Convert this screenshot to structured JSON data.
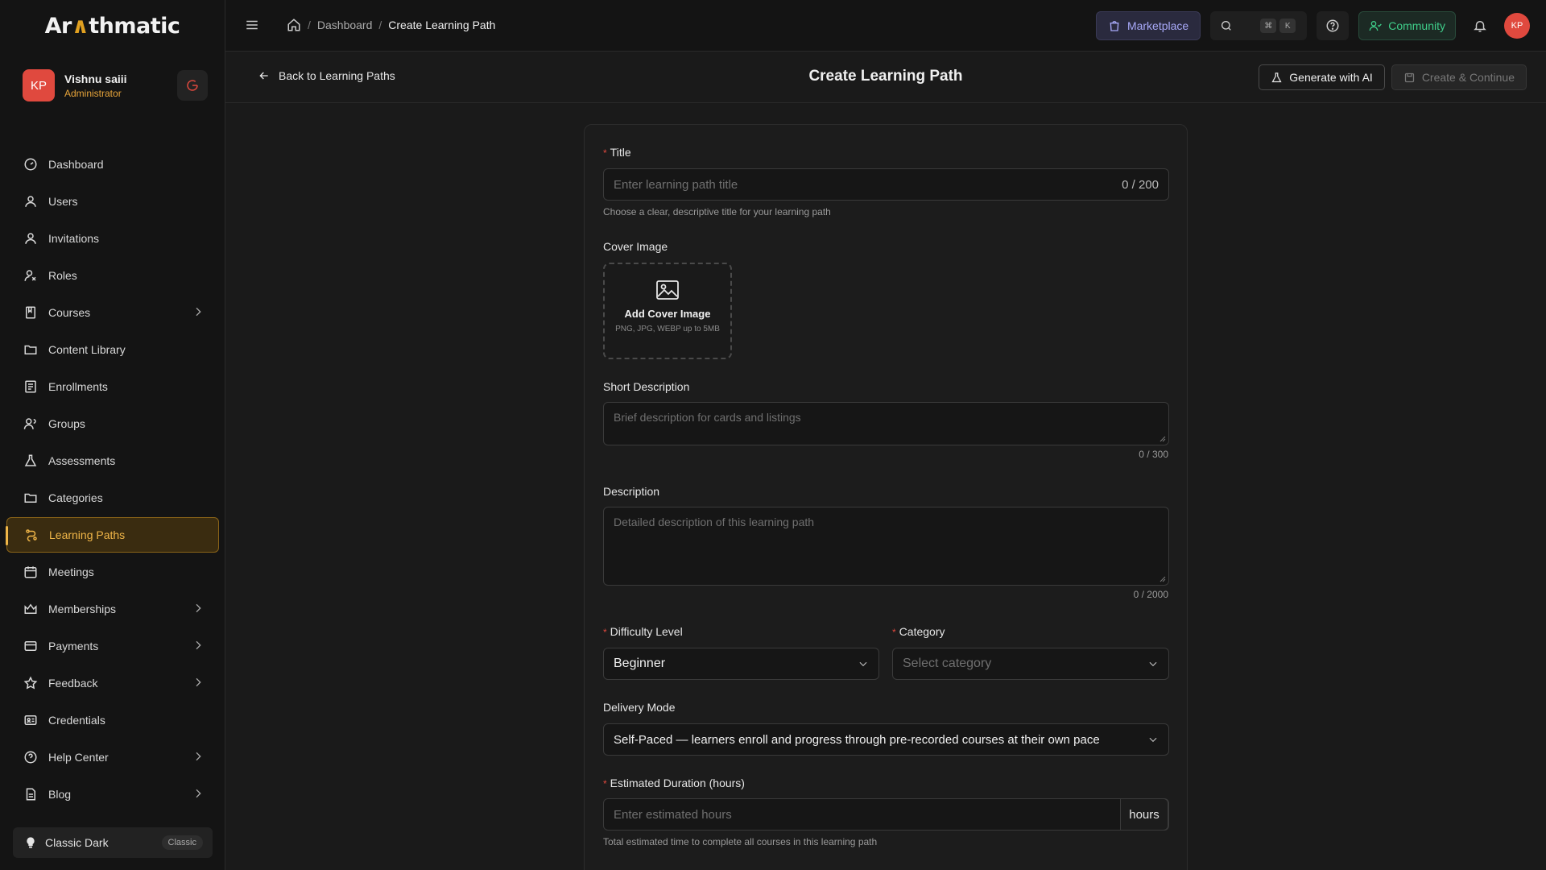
{
  "app": {
    "logo_prefix": "Ar",
    "logo_accent": "∧",
    "logo_suffix": "thmatic"
  },
  "user": {
    "initials": "KP",
    "name": "Vishnu saiii",
    "role": "Administrator"
  },
  "sidebar": {
    "items": [
      {
        "label": "Dashboard",
        "icon": "dashboard-icon"
      },
      {
        "label": "Users",
        "icon": "user-icon"
      },
      {
        "label": "Invitations",
        "icon": "user-icon"
      },
      {
        "label": "Roles",
        "icon": "roles-icon"
      },
      {
        "label": "Courses",
        "icon": "book-icon"
      },
      {
        "label": "Content Library",
        "icon": "folder-icon"
      },
      {
        "label": "Enrollments",
        "icon": "list-icon"
      },
      {
        "label": "Groups",
        "icon": "group-icon"
      },
      {
        "label": "Assessments",
        "icon": "flask-icon"
      },
      {
        "label": "Categories",
        "icon": "folder-icon"
      },
      {
        "label": "Learning Paths",
        "icon": "path-icon"
      },
      {
        "label": "Meetings",
        "icon": "calendar-icon"
      },
      {
        "label": "Memberships",
        "icon": "crown-icon"
      },
      {
        "label": "Payments",
        "icon": "card-icon"
      },
      {
        "label": "Feedback",
        "icon": "star-icon"
      },
      {
        "label": "Credentials",
        "icon": "id-card-icon"
      },
      {
        "label": "Help Center",
        "icon": "help-icon"
      },
      {
        "label": "Blog",
        "icon": "file-icon"
      }
    ],
    "active": "Learning Paths",
    "theme": {
      "label": "Classic Dark",
      "badge": "Classic"
    }
  },
  "topbar": {
    "breadcrumb": {
      "parent": "Dashboard",
      "current": "Create Learning Path"
    },
    "marketplace": "Marketplace",
    "kbd1": "⌘",
    "kbd2": "K",
    "community": "Community",
    "avatar": "KP"
  },
  "header": {
    "back": "Back to Learning Paths",
    "title": "Create Learning Path",
    "ai_button": "Generate with AI",
    "create_button": "Create & Continue"
  },
  "form": {
    "title": {
      "label": "Title",
      "placeholder": "Enter learning path title",
      "counter": "0 / 200",
      "help": "Choose a clear, descriptive title for your learning path"
    },
    "cover": {
      "label": "Cover Image",
      "button": "Add Cover Image",
      "hint": "PNG, JPG, WEBP up to 5MB"
    },
    "short_description": {
      "label": "Short Description",
      "placeholder": "Brief description for cards and listings",
      "counter": "0 / 300"
    },
    "description": {
      "label": "Description",
      "placeholder": "Detailed description of this learning path",
      "counter": "0 / 2000"
    },
    "difficulty": {
      "label": "Difficulty Level",
      "value": "Beginner"
    },
    "category": {
      "label": "Category",
      "placeholder": "Select category"
    },
    "delivery": {
      "label": "Delivery Mode",
      "value": "Self-Paced — learners enroll and progress through pre-recorded courses at their own pace"
    },
    "duration": {
      "label": "Estimated Duration (hours)",
      "placeholder": "Enter estimated hours",
      "suffix": "hours",
      "help": "Total estimated time to complete all courses in this learning path"
    }
  },
  "colors": {
    "accent": "#f0b648",
    "brand_red": "#e0493e",
    "market": "#a8a9f8",
    "community": "#3fce8a"
  }
}
